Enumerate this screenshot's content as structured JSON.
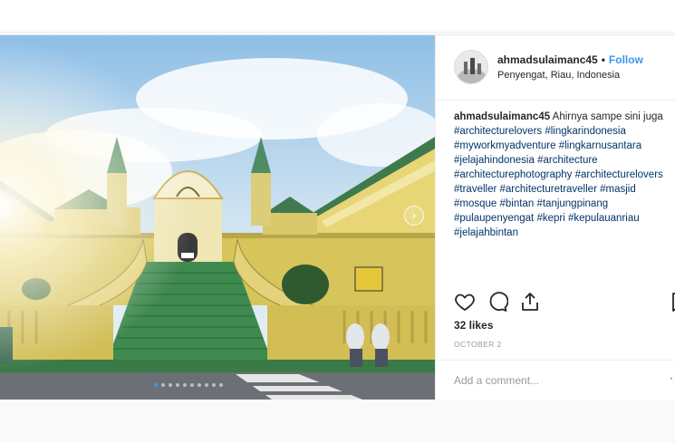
{
  "post": {
    "username": "ahmadsulaimanc45",
    "separator": "•",
    "follow_label": "Follow",
    "location": "Penyengat, Riau, Indonesia",
    "caption_author": "ahmadsulaimanc45",
    "caption_text": "Ahirnya sampe sini juga",
    "hashtags": [
      "#architecturelovers",
      "#lingkarindonesia",
      "#myworkmyadventure",
      "#lingkarnusantara",
      "#jelajahindonesia",
      "#architecture",
      "#architecturephotography",
      "#architecturelovers",
      "#traveller",
      "#architecturetraveller",
      "#masjid",
      "#mosque",
      "#bintan",
      "#tanjungpinang",
      "#pulaupenyengat",
      "#kepri",
      "#kepulauanriau",
      "#jelajahbintan"
    ],
    "likes": "32 likes",
    "date": "OCTOBER 2",
    "comment_placeholder": "Add a comment...",
    "more_label": "·",
    "carousel": {
      "count": 10,
      "active_index": 0
    }
  },
  "icons": {
    "like": "heart-icon",
    "comment": "comment-bubble-icon",
    "share": "share-icon",
    "save": "bookmark-icon",
    "next": "chevron-right-icon"
  },
  "colors": {
    "link": "#003569",
    "follow": "#3897f0",
    "carousel_active": "#2e9df7"
  }
}
